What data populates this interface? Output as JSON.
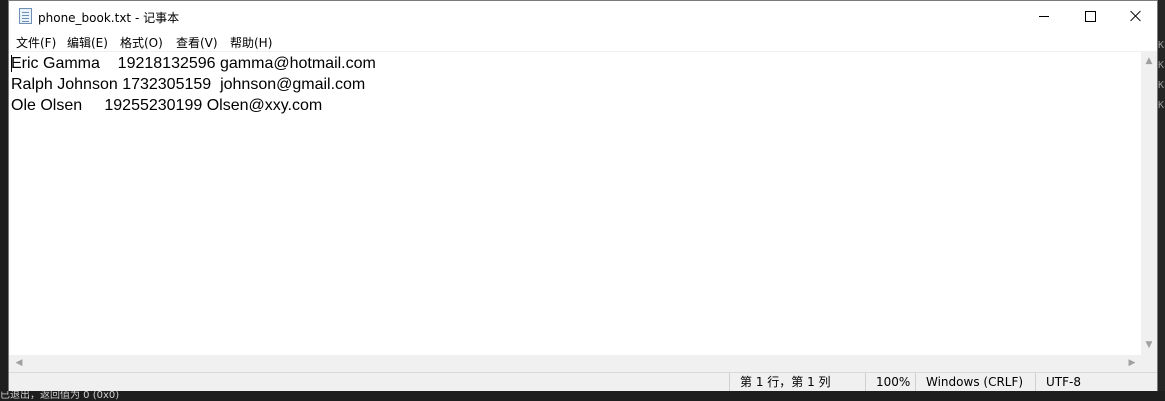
{
  "window": {
    "title": "phone_book.txt - 记事本",
    "buttons": {
      "minimize": "minimize-icon",
      "maximize": "maximize-icon",
      "close": "close-icon"
    }
  },
  "menu": {
    "items": [
      {
        "label": "文件(F)"
      },
      {
        "label": "编辑(E)"
      },
      {
        "label": "格式(O)"
      },
      {
        "label": "查看(V)"
      },
      {
        "label": "帮助(H)"
      }
    ]
  },
  "document": {
    "lines": [
      "Eric Gamma    19218132596 gamma@hotmail.com",
      "Ralph Johnson 1732305159  johnson@gmail.com",
      "Ole Olsen     19255230199 Olsen@xxy.com"
    ]
  },
  "status": {
    "position": "第 1 行，第 1 列",
    "zoom": "100%",
    "line_endings": "Windows (CRLF)",
    "encoding": "UTF-8"
  },
  "background": {
    "right_edge": [
      "KE",
      "KE",
      "KE",
      "KE"
    ],
    "bottom_text": "已退出，返回值为 0 (0x0)"
  }
}
